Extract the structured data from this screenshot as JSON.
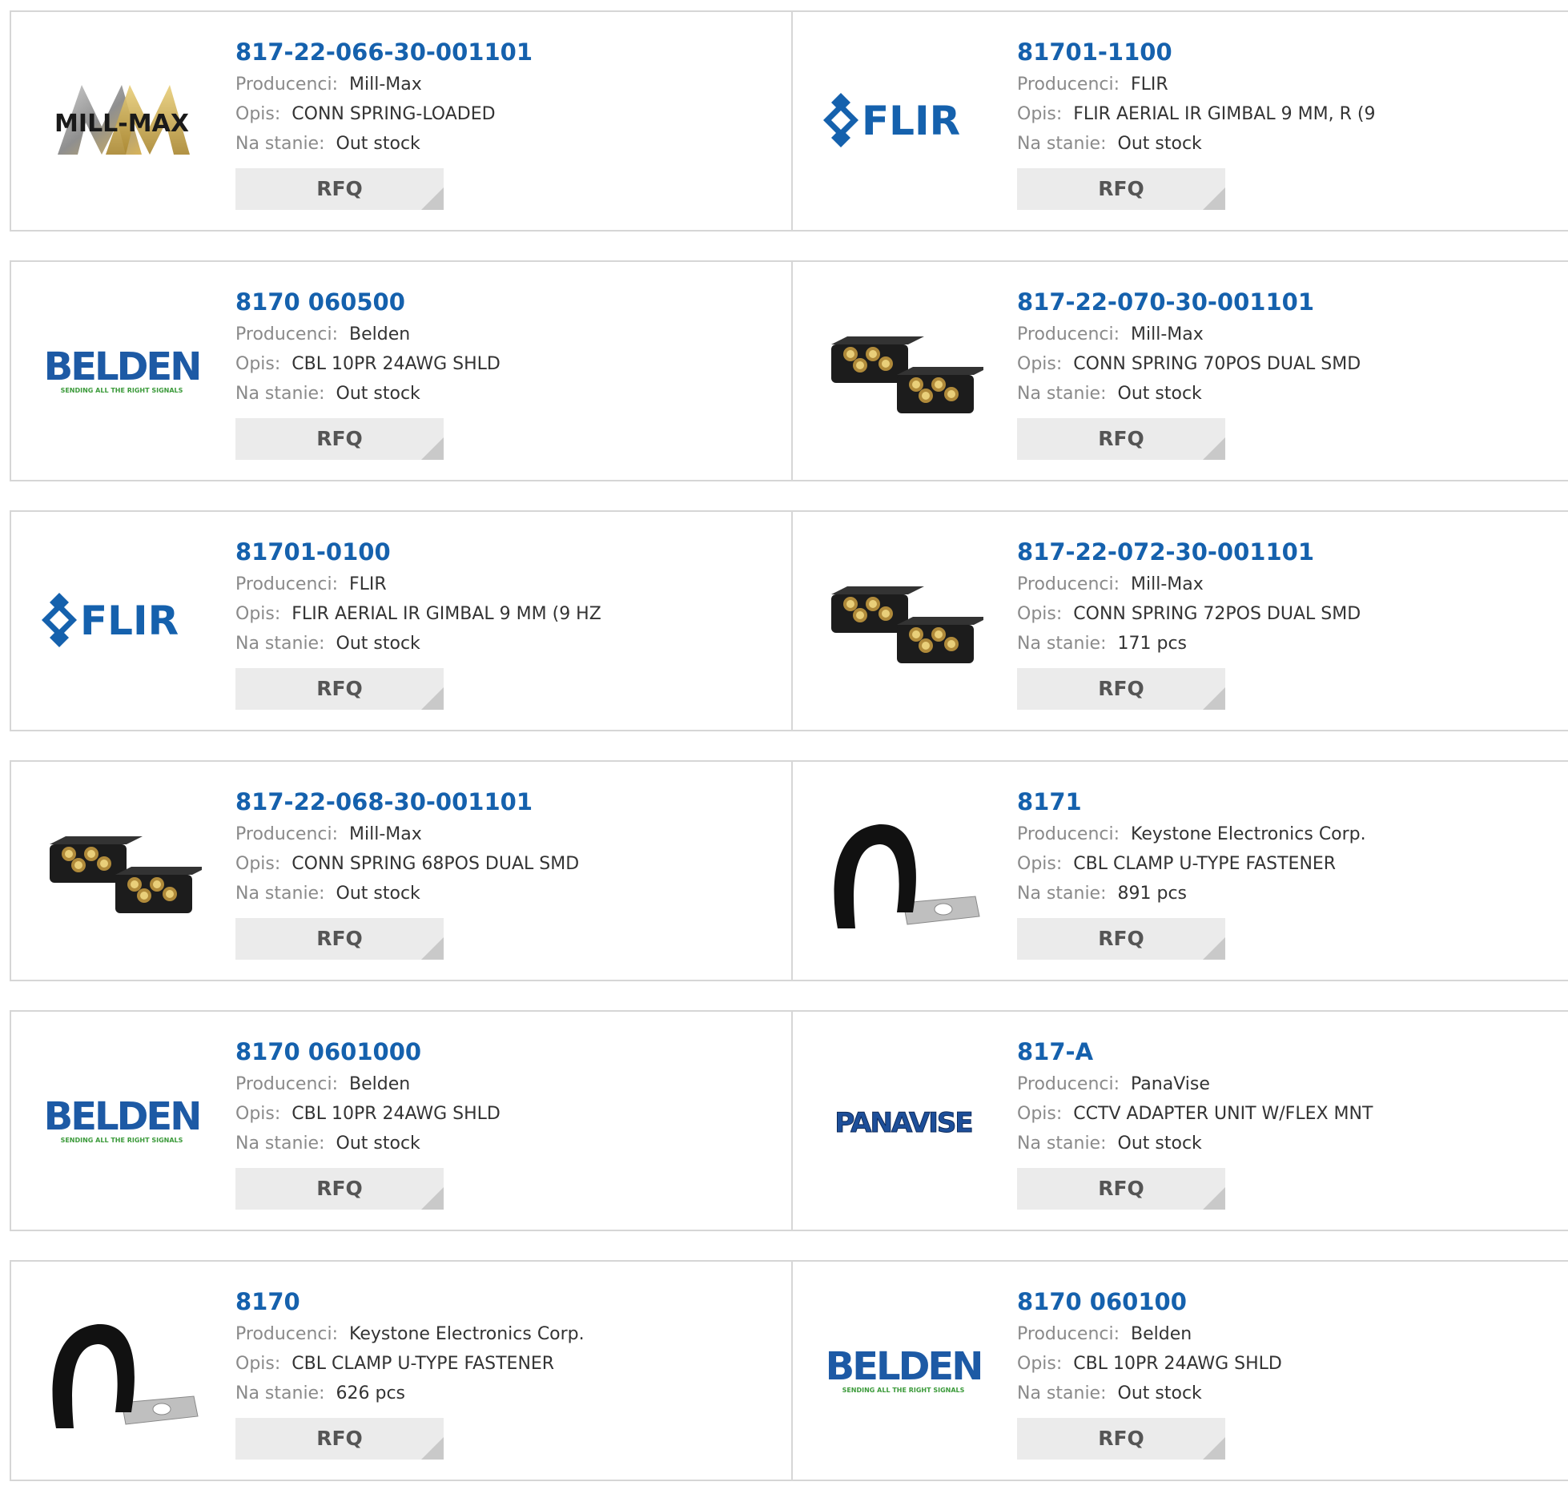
{
  "labels": {
    "manufacturer": "Producenci:",
    "description": "Opis:",
    "stock": "Na stanie:",
    "rfq": "RFQ"
  },
  "logos": {
    "millmax": "MILL-MAX",
    "flir": "FLIR",
    "belden": "BELDEN",
    "belden_tag": "SENDING ALL THE RIGHT SIGNALS",
    "panavise": "PANAVISE"
  },
  "products": [
    {
      "part": "817-22-066-30-001101",
      "manufacturer": "Mill-Max",
      "description": "CONN SPRING-LOADED",
      "stock": "Out stock",
      "image": "millmax-logo"
    },
    {
      "part": "81701-1100",
      "manufacturer": "FLIR",
      "description": "FLIR AERIAL IR GIMBAL 9 MM, R (9",
      "stock": "Out stock",
      "image": "flir-logo"
    },
    {
      "part": "8170 060500",
      "manufacturer": "Belden",
      "description": "CBL 10PR 24AWG SHLD",
      "stock": "Out stock",
      "image": "belden-logo"
    },
    {
      "part": "817-22-070-30-001101",
      "manufacturer": "Mill-Max",
      "description": "CONN SPRING 70POS DUAL SMD",
      "stock": "Out stock",
      "image": "connector-photo"
    },
    {
      "part": "81701-0100",
      "manufacturer": "FLIR",
      "description": "FLIR AERIAL IR GIMBAL 9 MM (9 HZ",
      "stock": "Out stock",
      "image": "flir-logo"
    },
    {
      "part": "817-22-072-30-001101",
      "manufacturer": "Mill-Max",
      "description": "CONN SPRING 72POS DUAL SMD",
      "stock": "171 pcs",
      "image": "connector-photo"
    },
    {
      "part": "817-22-068-30-001101",
      "manufacturer": "Mill-Max",
      "description": "CONN SPRING 68POS DUAL SMD",
      "stock": "Out stock",
      "image": "connector-photo"
    },
    {
      "part": "8171",
      "manufacturer": "Keystone Electronics Corp.",
      "description": "CBL CLAMP U-TYPE FASTENER",
      "stock": "891 pcs",
      "image": "clamp-photo"
    },
    {
      "part": "8170 0601000",
      "manufacturer": "Belden",
      "description": "CBL 10PR 24AWG SHLD",
      "stock": "Out stock",
      "image": "belden-logo"
    },
    {
      "part": "817-A",
      "manufacturer": "PanaVise",
      "description": "CCTV ADAPTER UNIT W/FLEX MNT",
      "stock": "Out stock",
      "image": "panavise-logo"
    },
    {
      "part": "8170",
      "manufacturer": "Keystone Electronics Corp.",
      "description": "CBL CLAMP U-TYPE FASTENER",
      "stock": "626 pcs",
      "image": "clamp-photo"
    },
    {
      "part": "8170 060100",
      "manufacturer": "Belden",
      "description": "CBL 10PR 24AWG SHLD",
      "stock": "Out stock",
      "image": "belden-logo"
    }
  ]
}
